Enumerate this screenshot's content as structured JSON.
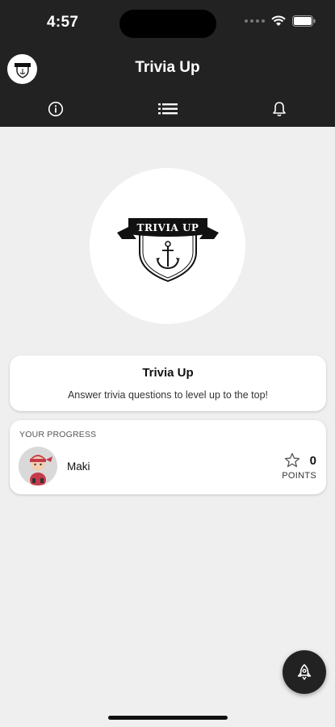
{
  "status_bar": {
    "time": "4:57"
  },
  "app_bar": {
    "title": "Trivia Up"
  },
  "tabs": [
    {
      "icon": "info-icon"
    },
    {
      "icon": "list-icon"
    },
    {
      "icon": "bell-icon"
    }
  ],
  "logo": {
    "text": "TRIVIA UP"
  },
  "info_card": {
    "title": "Trivia Up",
    "description": "Answer trivia questions to level up to the top!"
  },
  "progress": {
    "heading": "YOUR PROGRESS",
    "user_name": "Maki",
    "points": "0",
    "points_label": "POINTS"
  },
  "fab": {
    "icon": "rocket-icon"
  },
  "colors": {
    "header": "#222222",
    "background": "#efefef",
    "card": "#ffffff"
  }
}
